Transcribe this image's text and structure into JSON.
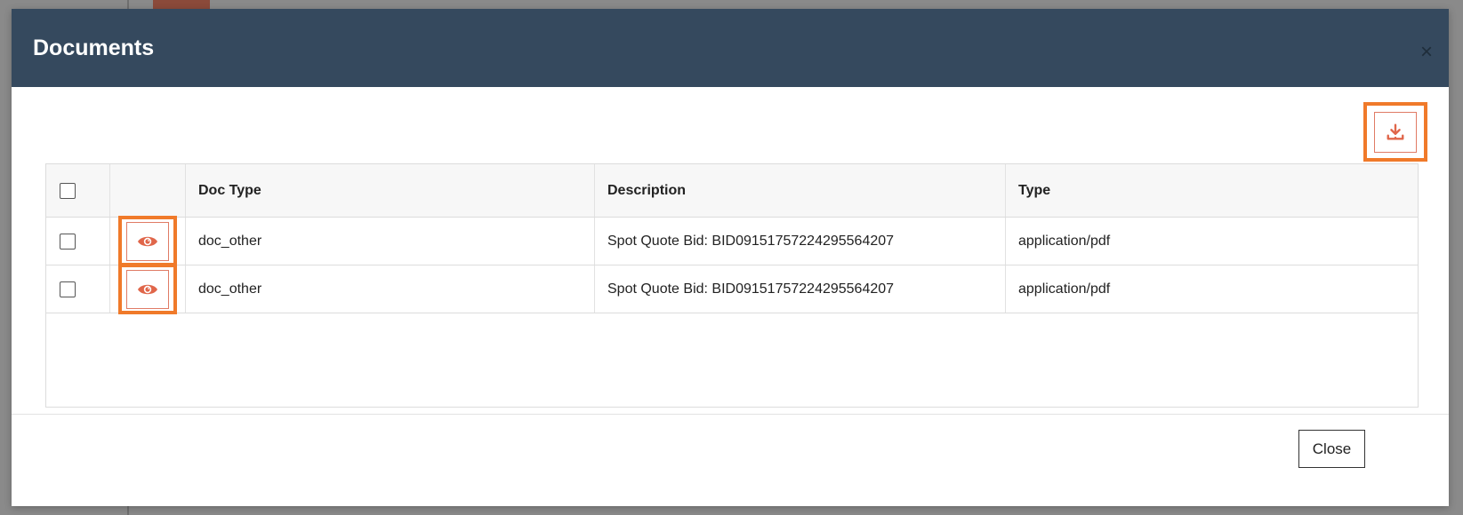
{
  "modal": {
    "title": "Documents",
    "close_icon": "close-icon",
    "download_icon": "download-icon",
    "close_button_label": "Close"
  },
  "table": {
    "columns": [
      "",
      "",
      "Doc Type",
      "Description",
      "Type"
    ],
    "rows": [
      {
        "doc_type": "doc_other",
        "description": "Spot Quote Bid: BID09151757224295564207",
        "type": "application/pdf",
        "view_icon": "eye-icon"
      },
      {
        "doc_type": "doc_other",
        "description": "Spot Quote Bid: BID09151757224295564207",
        "type": "application/pdf",
        "view_icon": "eye-icon"
      }
    ]
  },
  "colors": {
    "header_bg": "#35495e",
    "accent": "#f07a2a",
    "icon": "#e0664a"
  }
}
